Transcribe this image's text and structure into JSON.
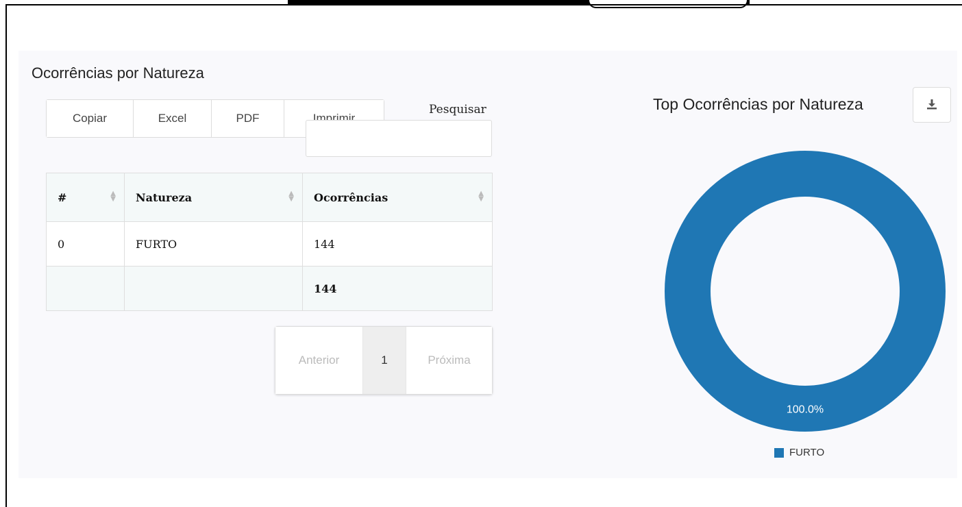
{
  "section": {
    "title": "Ocorrências por Natureza"
  },
  "toolbar": {
    "copy": "Copiar",
    "excel": "Excel",
    "pdf": "PDF",
    "print": "Imprimir"
  },
  "search": {
    "label": "Pesquisar",
    "value": ""
  },
  "table": {
    "headers": {
      "index": "#",
      "natureza": "Natureza",
      "ocorrencias": "Ocorrências"
    },
    "rows": [
      {
        "index": "0",
        "natureza": "FURTO",
        "ocorrencias": "144"
      }
    ],
    "total": {
      "index": "",
      "natureza": "",
      "ocorrencias": "144"
    }
  },
  "pagination": {
    "prev": "Anterior",
    "current": "1",
    "next": "Próxima"
  },
  "chart": {
    "title": "Top Ocorrências por Natureza",
    "download_icon": "download-icon",
    "color": "#1f77b4"
  },
  "chart_data": {
    "type": "pie",
    "categories": [
      "FURTO"
    ],
    "values": [
      100.0
    ],
    "labels": [
      "100.0%"
    ],
    "legend": [
      "FURTO"
    ],
    "legend_position": "bottom",
    "colors": [
      "#1f77b4"
    ]
  }
}
